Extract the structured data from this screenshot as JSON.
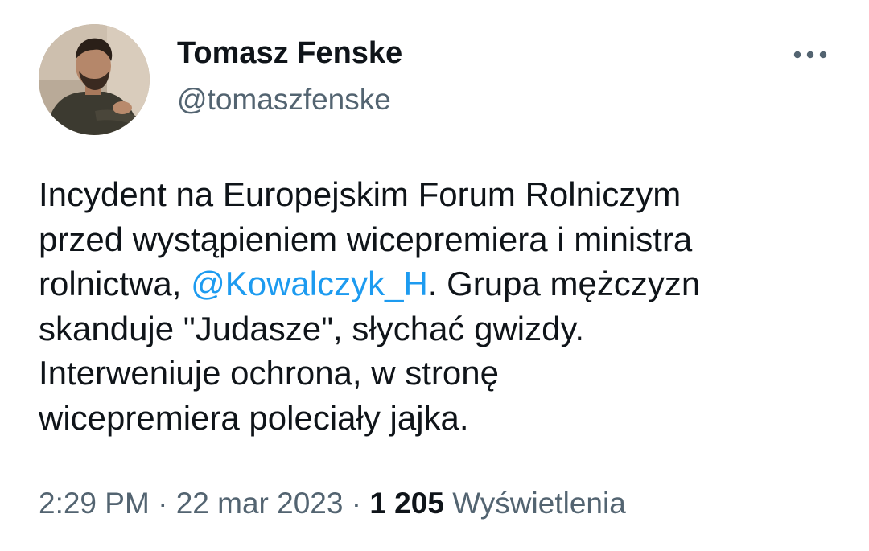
{
  "author": {
    "display_name": "Tomasz Fenske",
    "handle": "@tomaszfenske"
  },
  "more_icon": "more-horizontal-icon",
  "tweet": {
    "line1": "Incydent na Europejskim Forum Rolniczym",
    "line2": "przed wystąpieniem wicepremiera i ministra",
    "line3_prefix": "rolnictwa, ",
    "mention": "@Kowalczyk_H",
    "line3_suffix": ". Grupa mężczyzn",
    "line4": "skanduje \"Judasze\", słychać gwizdy.",
    "line5": "Interweniuje ochrona, w stronę",
    "line6": "wicepremiera poleciały jajka."
  },
  "meta": {
    "time": "2:29 PM",
    "separator": " · ",
    "date": "22 mar 2023",
    "views_count": "1 205",
    "views_label": "Wyświetlenia"
  },
  "colors": {
    "text": "#0f1419",
    "secondary": "#536471",
    "link": "#1d9bf0"
  }
}
